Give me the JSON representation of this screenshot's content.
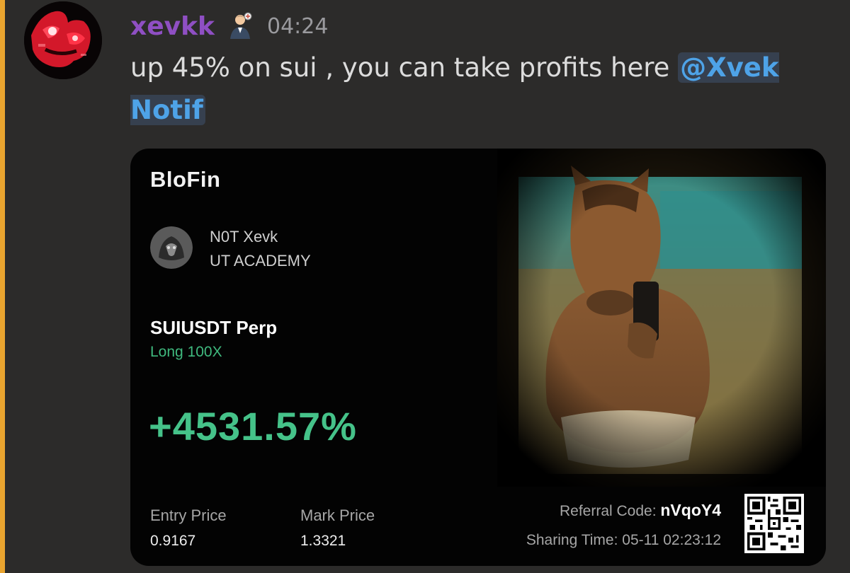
{
  "message": {
    "author": "xevkk",
    "role_icon": "person-with-badge-icon",
    "time": "04:24",
    "text": "up 45% on sui , you can take profits here ",
    "mention": "@Xvek Notif"
  },
  "card": {
    "brand": "BloFin",
    "account_name": "N0T Xevk",
    "account_team": "UT ACADEMY",
    "pair": "SUIUSDT Perp",
    "position": "Long  100X",
    "pnl": "+4531.57%",
    "entry_label": "Entry Price",
    "entry_value": "0.9167",
    "mark_label": "Mark Price",
    "mark_value": "1.3321",
    "referral_label": "Referral Code: ",
    "referral_code": "nVqoY4",
    "sharing_time": "Sharing Time: 05-11 02:23:12"
  },
  "colors": {
    "mention_bar": "#e9a42f",
    "username": "#8f4fc3",
    "mention_text": "#4ea3e8",
    "pnl_green": "#45c289"
  }
}
